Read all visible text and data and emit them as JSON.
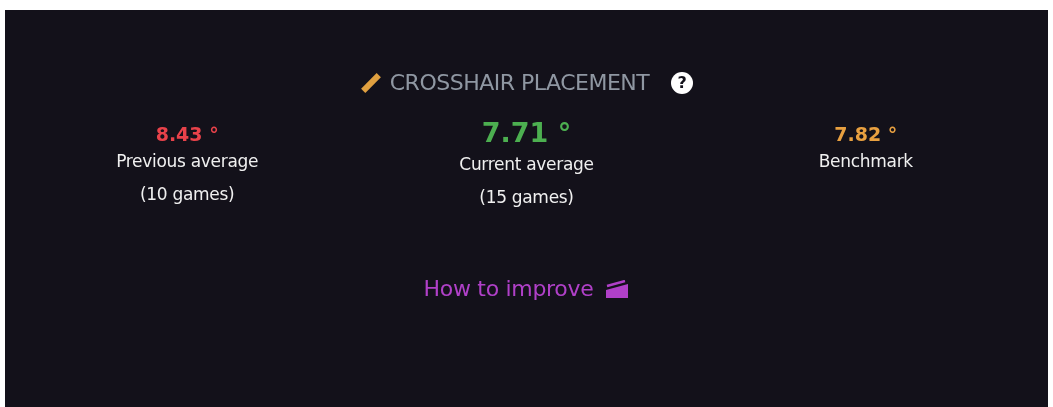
{
  "card": {
    "title": "CROSSHAIR PLACEMENT",
    "help_icon_label": "?",
    "stats": [
      {
        "kind": "side",
        "value": "8.43 °",
        "color": "#e8424a",
        "label": "Previous average",
        "sub": "(10 games)"
      },
      {
        "kind": "main",
        "value": "7.71 °",
        "color": "#4caf50",
        "label": "Current average",
        "sub": "(15 games)"
      },
      {
        "kind": "side",
        "value": "7.82 °",
        "color": "#e8a040",
        "label": "Benchmark"
      }
    ],
    "link": "How to improve"
  }
}
